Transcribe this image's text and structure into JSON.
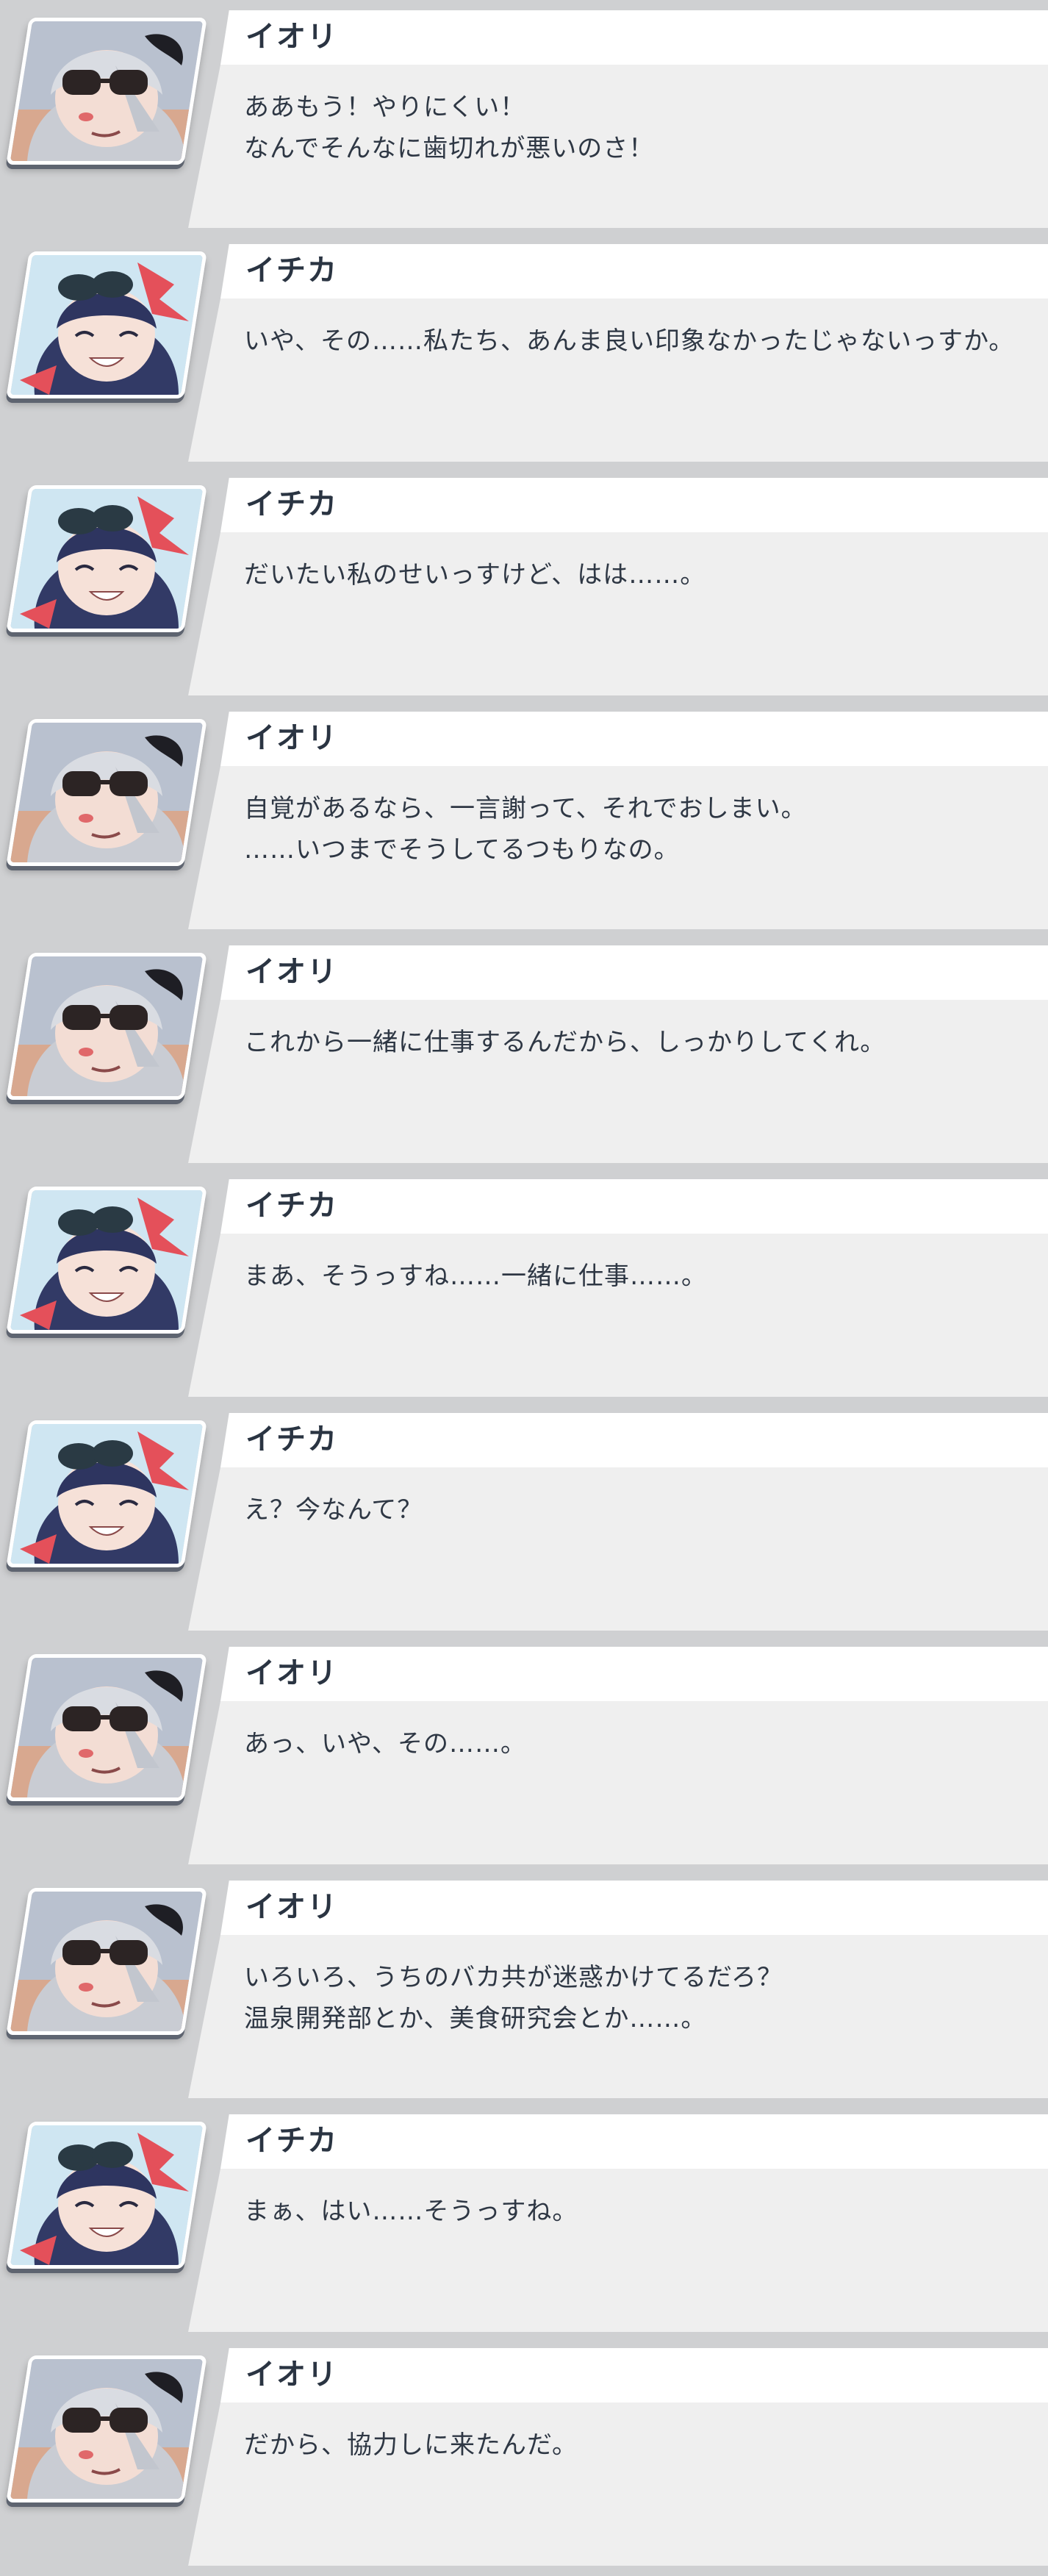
{
  "dialogue_log": {
    "entries": [
      {
        "speaker": "イオリ",
        "character": "iori",
        "lines": [
          "ああもう！やりにくい！",
          "なんでそんなに歯切れが悪いのさ！"
        ]
      },
      {
        "speaker": "イチカ",
        "character": "ichika",
        "lines": [
          "いや、その……私たち、あんま良い印象なかったじゃないっすか。",
          ""
        ]
      },
      {
        "speaker": "イチカ",
        "character": "ichika",
        "lines": [
          "だいたい私のせいっすけど、はは……。",
          ""
        ]
      },
      {
        "speaker": "イオリ",
        "character": "iori",
        "lines": [
          "自覚があるなら、一言謝って、それでおしまい。",
          "……いつまでそうしてるつもりなの。"
        ]
      },
      {
        "speaker": "イオリ",
        "character": "iori",
        "lines": [
          "これから一緒に仕事するんだから、しっかりしてくれ。",
          ""
        ]
      },
      {
        "speaker": "イチカ",
        "character": "ichika",
        "lines": [
          "まあ、そうっすね……一緒に仕事……。",
          ""
        ]
      },
      {
        "speaker": "イチカ",
        "character": "ichika",
        "lines": [
          "え？今なんて？",
          ""
        ]
      },
      {
        "speaker": "イオリ",
        "character": "iori",
        "lines": [
          "あっ、いや、その……。",
          ""
        ]
      },
      {
        "speaker": "イオリ",
        "character": "iori",
        "lines": [
          "いろいろ、うちのバカ共が迷惑かけてるだろ？",
          "温泉開発部とか、美食研究会とか……。"
        ]
      },
      {
        "speaker": "イチカ",
        "character": "ichika",
        "lines": [
          "まぁ、はい……そうっすね。",
          ""
        ]
      },
      {
        "speaker": "イオリ",
        "character": "iori",
        "lines": [
          "だから、協力しに来たんだ。",
          ""
        ]
      }
    ]
  },
  "colors": {
    "background": "#cfd0d2",
    "name_bar": "#ffffff",
    "text_box": "#efefef",
    "name_text": "#2a3442",
    "body_text": "#2e3744",
    "iori_hair": "#c9ccd3",
    "ichika_hair": "#323a66",
    "ichika_halo": "#e4505a"
  }
}
